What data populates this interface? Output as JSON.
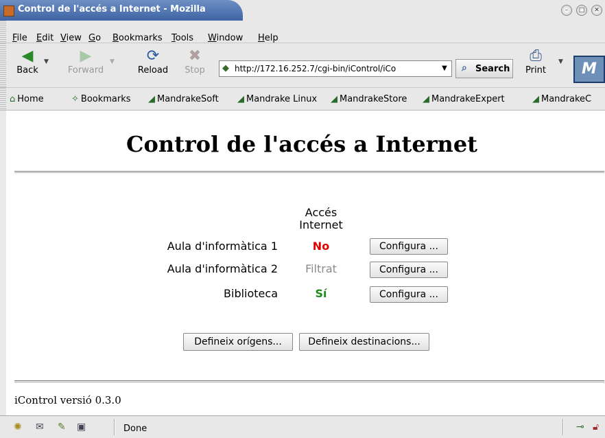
{
  "window": {
    "title": "Control de l'accés a Internet - Mozilla"
  },
  "menu": [
    "File",
    "Edit",
    "View",
    "Go",
    "Bookmarks",
    "Tools",
    "Window",
    "Help"
  ],
  "toolbar": {
    "back": "Back",
    "forward": "Forward",
    "reload": "Reload",
    "stop": "Stop",
    "url": "http://172.16.252.7/cgi-bin/iControl/iCo",
    "search": "Search",
    "print": "Print"
  },
  "bookmarks": [
    "Home",
    "Bookmarks",
    "MandrakeSoft",
    "Mandrake Linux",
    "MandrakeStore",
    "MandrakeExpert",
    "MandrakeC"
  ],
  "page": {
    "title": "Control de l'accés a Internet",
    "column_header": [
      "Accés",
      "Internet"
    ],
    "rows": [
      {
        "name": "Aula d'informàtica 1",
        "status": "No",
        "status_color": "#e00000",
        "button": "Configura ..."
      },
      {
        "name": "Aula d'informàtica 2",
        "status": "Filtrat",
        "status_color": "#8a8a8a",
        "button": "Configura ..."
      },
      {
        "name": "Biblioteca",
        "status": "Sí",
        "status_color": "#1e8a1e",
        "button": "Configura ..."
      }
    ],
    "origins_button": "Defineix orígens...",
    "destinations_button": "Defineix destinacions...",
    "footer": "iControl versió 0.3.0"
  },
  "statusbar": {
    "text": "Done"
  }
}
